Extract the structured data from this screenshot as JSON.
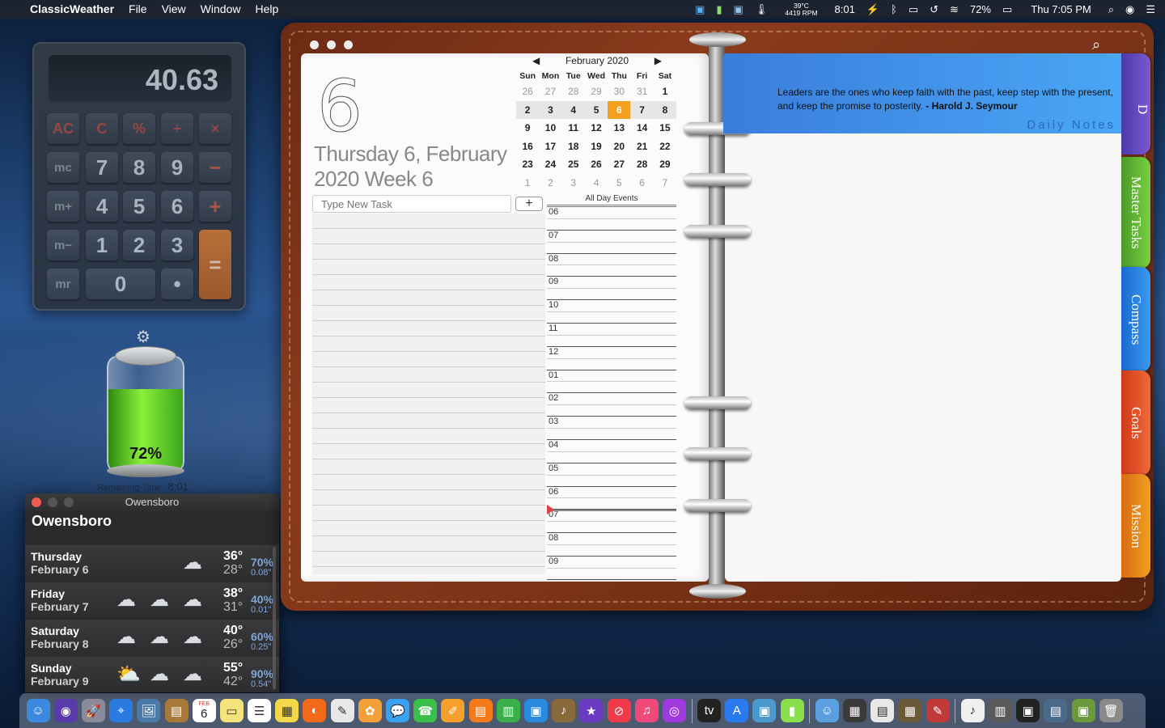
{
  "menubar": {
    "app_name": "ClassicWeather",
    "menus": [
      "File",
      "View",
      "Window",
      "Help"
    ],
    "sensor_temp": "39°C",
    "sensor_rpm": "4419 RPM",
    "battery_time": "8:01",
    "battery_pct": "72%",
    "clock": "Thu 7:05 PM"
  },
  "calculator": {
    "display": "40.63",
    "keys": {
      "ac": "AC",
      "c": "C",
      "pct": "%",
      "div": "÷",
      "mul": "×",
      "mc": "mc",
      "mplus": "m+",
      "mminus": "m−",
      "mr": "mr",
      "k7": "7",
      "k8": "8",
      "k9": "9",
      "minus": "−",
      "k4": "4",
      "k5": "5",
      "k6": "6",
      "plus": "+",
      "k1": "1",
      "k2": "2",
      "k3": "3",
      "eq": "=",
      "k0": "0",
      "dot": "•"
    }
  },
  "battery_widget": {
    "percent": "72%",
    "level": 0.72,
    "remaining_label": "Remaining Time",
    "remaining_value": "8:01"
  },
  "weather": {
    "window_title": "Owensboro",
    "city": "Owensboro",
    "days": [
      {
        "day": "Thursday",
        "date": "February 6",
        "hi": "36°",
        "lo": "28°",
        "pop": "70%",
        "precip": "0.08\""
      },
      {
        "day": "Friday",
        "date": "February 7",
        "hi": "38°",
        "lo": "31°",
        "pop": "40%",
        "precip": "0.01\""
      },
      {
        "day": "Saturday",
        "date": "February 8",
        "hi": "40°",
        "lo": "26°",
        "pop": "60%",
        "precip": "0.25\""
      },
      {
        "day": "Sunday",
        "date": "February 9",
        "hi": "55°",
        "lo": "42°",
        "pop": "90%",
        "precip": "0.54\""
      }
    ]
  },
  "planner": {
    "day_number": "6",
    "date_long": "Thursday 6, February 2020 Week 6",
    "task_placeholder": "Type New Task",
    "add_label": "+",
    "calendar": {
      "month_label": "February 2020",
      "prev": "◀",
      "next": "▶",
      "weekdays": [
        "Sun",
        "Mon",
        "Tue",
        "Wed",
        "Thu",
        "Fri",
        "Sat"
      ],
      "weeks": [
        [
          "26",
          "27",
          "28",
          "29",
          "30",
          "31",
          "1"
        ],
        [
          "2",
          "3",
          "4",
          "5",
          "6",
          "7",
          "8"
        ],
        [
          "9",
          "10",
          "11",
          "12",
          "13",
          "14",
          "15"
        ],
        [
          "16",
          "17",
          "18",
          "19",
          "20",
          "21",
          "22"
        ],
        [
          "23",
          "24",
          "25",
          "26",
          "27",
          "28",
          "29"
        ],
        [
          "1",
          "2",
          "3",
          "4",
          "5",
          "6",
          "7"
        ]
      ]
    },
    "all_day_label": "All Day Events",
    "hours": [
      "06",
      "07",
      "08",
      "09",
      "10",
      "11",
      "12",
      "01",
      "02",
      "03",
      "04",
      "05",
      "06",
      "07",
      "08",
      "09"
    ],
    "quote_text": "Leaders are the ones who keep faith with the past, keep step with the present, and keep the promise to posterity.",
    "quote_author": "- Harold J. Seymour",
    "daily_notes": "Daily Notes",
    "tabs": [
      "D",
      "Master Tasks",
      "Compass",
      "Goals",
      "Mission"
    ]
  },
  "dock": {
    "apps": [
      "Finder",
      "Siri",
      "Launchpad",
      "Safari",
      "Preview",
      "Notefile",
      "Calendar",
      "Notes",
      "Reminders",
      "Stickies",
      "Firefox",
      "TextEdit",
      "Photos",
      "Messages",
      "FaceTime",
      "Pages",
      "Books",
      "Numbers",
      "Keynote",
      "Instruments",
      "iMovie",
      "News",
      "Music",
      "Podcasts",
      "TV",
      "App Store",
      "Preview",
      "Battery",
      "Finder Alt",
      "Calculator",
      "Notes Pad",
      "Migration",
      "Pencil",
      "Script",
      "Grapher",
      "Terminal",
      "Network",
      "Photos 2",
      "Trash"
    ],
    "calendar_date": "6",
    "calendar_month": "FEB"
  }
}
